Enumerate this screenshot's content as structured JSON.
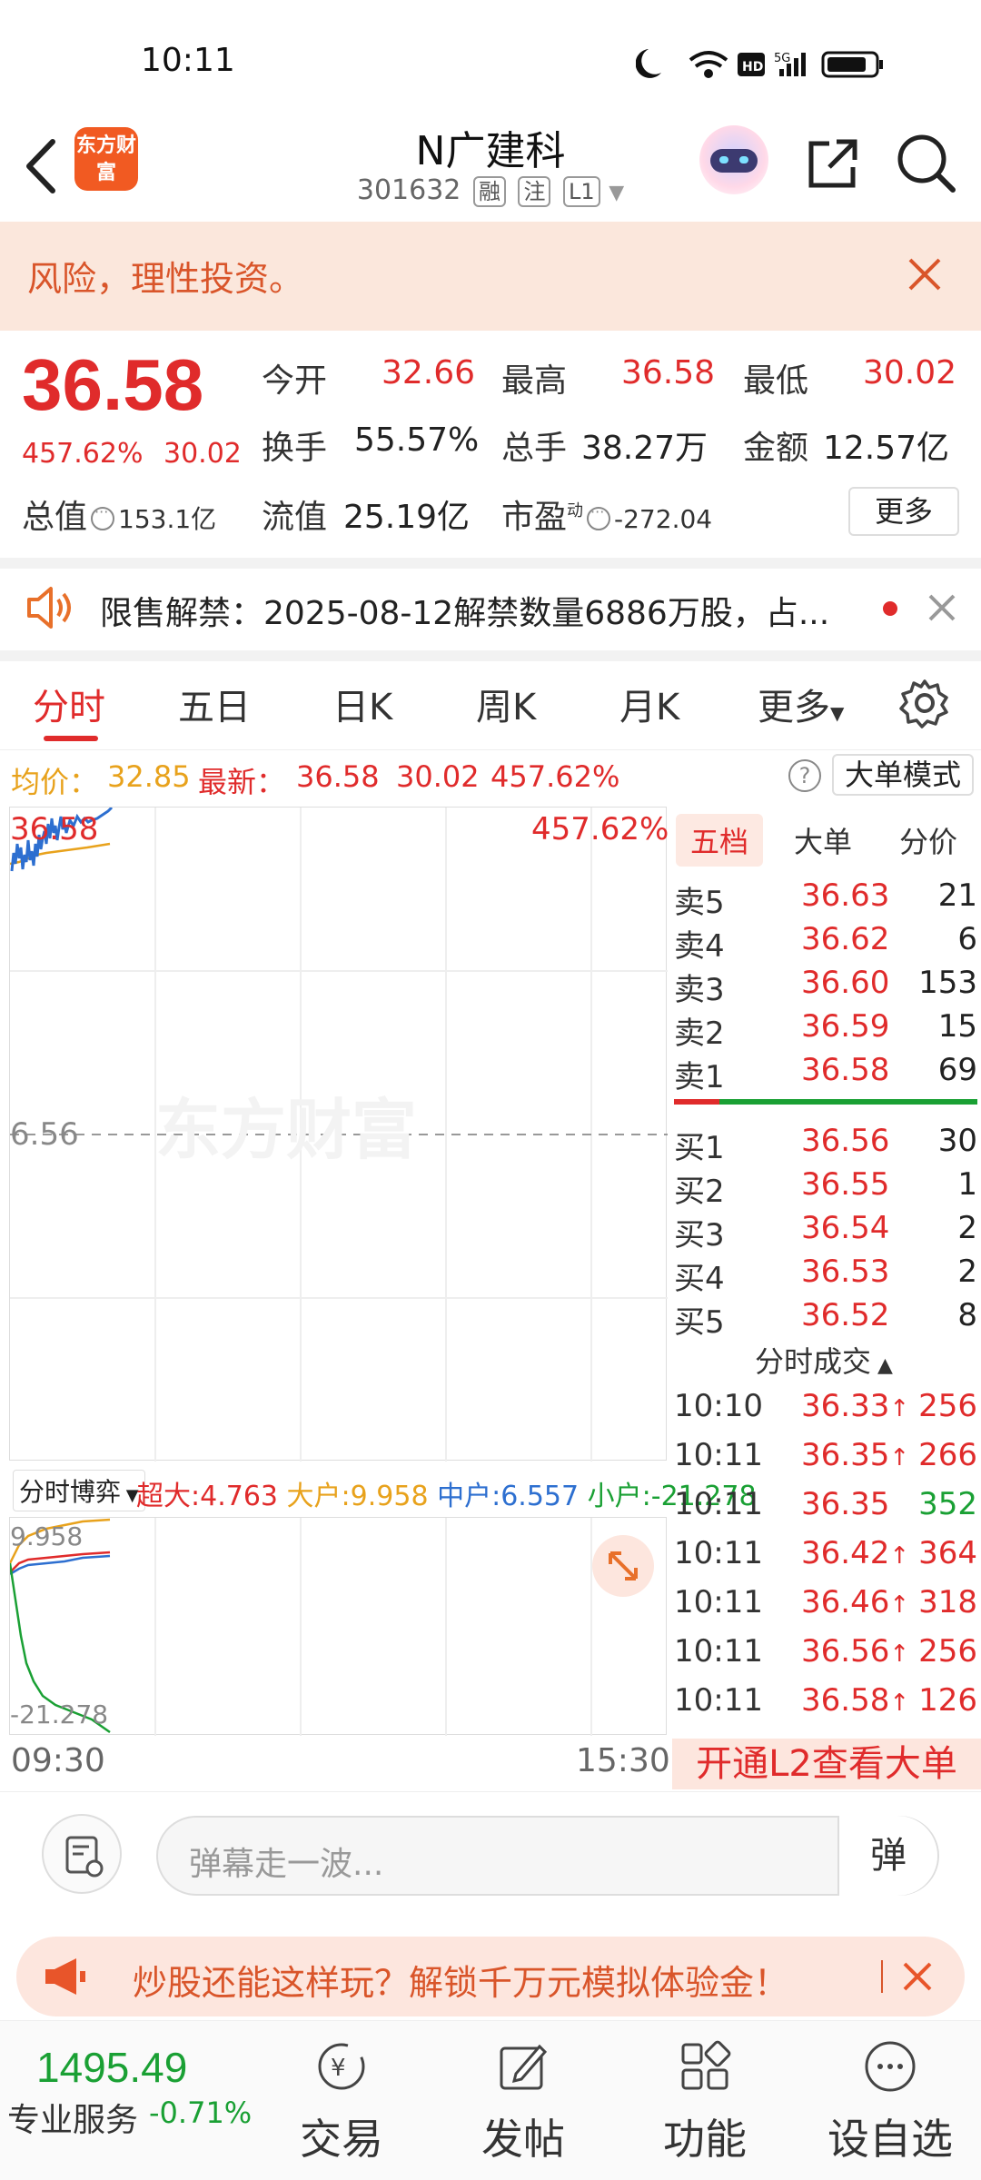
{
  "status": {
    "time": "10:11"
  },
  "header": {
    "title": "N广建科",
    "code": "301632",
    "tags": [
      "融",
      "注",
      "L1"
    ],
    "logo_text": "东方财富"
  },
  "risk_banner": {
    "text": "风险，理性投资。"
  },
  "quote": {
    "price": "36.58",
    "change_pct": "457.62%",
    "change_amt": "30.02",
    "open_label": "今开",
    "open": "32.66",
    "high_label": "最高",
    "high": "36.58",
    "low_label": "最低",
    "low": "30.02",
    "turnover_label": "换手",
    "turnover": "55.57%",
    "volume_label": "总手",
    "volume": "38.27万",
    "amount_label": "金额",
    "amount": "12.57亿",
    "total_value_label": "总值",
    "total_value": "153.1亿",
    "float_value_label": "流值",
    "float_value": "25.19亿",
    "pe_label": "市盈",
    "pe_sup": "动",
    "pe": "-272.04",
    "more_label": "更多"
  },
  "notice": {
    "text": "限售解禁：2025-08-12解禁数量6886万股，占..."
  },
  "tabs": [
    "分时",
    "五日",
    "日K",
    "周K",
    "月K",
    "更多"
  ],
  "infobar": {
    "avg_label": "均价：",
    "avg": "32.85",
    "latest_label": "最新：",
    "latest": "36.58",
    "chg": "30.02",
    "pct": "457.62%",
    "help": "?",
    "mode_label": "大单模式"
  },
  "chart": {
    "top_price": "36.58",
    "top_pct": "457.62%",
    "mid_price": "6.56",
    "watermark": "东方财富",
    "time_start": "09:30",
    "time_end": "15:30"
  },
  "subchart": {
    "dropdown": "分时博弈",
    "super_label": "超大:",
    "super": "4.763",
    "big_label": "大户:",
    "big": "9.958",
    "mid_label": "中户:",
    "mid": "6.557",
    "small_label": "小户:",
    "small": "-21.278",
    "max": "9.958",
    "min": "-21.278"
  },
  "book": {
    "tabs": [
      "五档",
      "大单",
      "分价"
    ],
    "asks": [
      {
        "label": "卖5",
        "price": "36.63",
        "vol": "21"
      },
      {
        "label": "卖4",
        "price": "36.62",
        "vol": "6"
      },
      {
        "label": "卖3",
        "price": "36.60",
        "vol": "153"
      },
      {
        "label": "卖2",
        "price": "36.59",
        "vol": "15"
      },
      {
        "label": "卖1",
        "price": "36.58",
        "vol": "69"
      }
    ],
    "bids": [
      {
        "label": "买1",
        "price": "36.56",
        "vol": "30"
      },
      {
        "label": "买2",
        "price": "36.55",
        "vol": "1"
      },
      {
        "label": "买3",
        "price": "36.54",
        "vol": "2"
      },
      {
        "label": "买4",
        "price": "36.53",
        "vol": "2"
      },
      {
        "label": "买5",
        "price": "36.52",
        "vol": "8"
      }
    ],
    "ticks_title": "分时成交",
    "ticks": [
      {
        "time": "10:10",
        "price": "36.33",
        "arrow": "↑",
        "vol": "256",
        "color": "red"
      },
      {
        "time": "10:11",
        "price": "36.35",
        "arrow": "↑",
        "vol": "266",
        "color": "red"
      },
      {
        "time": "10:11",
        "price": "36.35",
        "arrow": "",
        "vol": "352",
        "color": "green"
      },
      {
        "time": "10:11",
        "price": "36.42",
        "arrow": "↑",
        "vol": "364",
        "color": "red"
      },
      {
        "time": "10:11",
        "price": "36.46",
        "arrow": "↑",
        "vol": "318",
        "color": "red"
      },
      {
        "time": "10:11",
        "price": "36.56",
        "arrow": "↑",
        "vol": "256",
        "color": "red"
      },
      {
        "time": "10:11",
        "price": "36.58",
        "arrow": "↑",
        "vol": "126",
        "color": "red"
      }
    ],
    "l2_label": "开通L2查看大单"
  },
  "danmu": {
    "placeholder": "弹幕走一波...",
    "send": "弹"
  },
  "promo": {
    "text": "炒股还能这样玩？解锁千万元模拟体验金！"
  },
  "bottom": {
    "index_value": "1495.49",
    "index_label": "专业服务",
    "index_change": "-0.71%",
    "nav": [
      "交易",
      "发帖",
      "功能",
      "设自选"
    ]
  },
  "colors": {
    "up": "#e02b2b",
    "down": "#1aa034",
    "accent": "#f15a22",
    "avg_line": "#e8a21c",
    "price_line": "#2d6fd0"
  }
}
